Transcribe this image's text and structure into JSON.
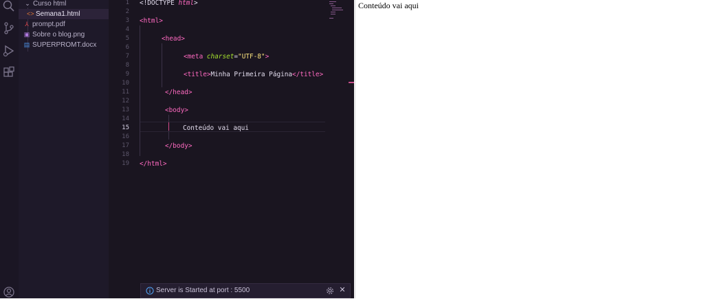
{
  "activity_bar": {
    "icons": [
      "search-icon",
      "source-control-icon",
      "run-debug-icon",
      "extensions-icon",
      "account-icon"
    ]
  },
  "explorer": {
    "folder_label": "Curso html",
    "files": [
      {
        "label": "Semana1.html",
        "icon": "html-file-icon",
        "active": true
      },
      {
        "label": "prompt.pdf",
        "icon": "pdf-file-icon",
        "active": false
      },
      {
        "label": "Sobre o blog.png",
        "icon": "image-file-icon",
        "active": false
      },
      {
        "label": "SUPERPROMT.docx",
        "icon": "word-file-icon",
        "active": false
      }
    ]
  },
  "editor": {
    "current_line": "15",
    "line_numbers": [
      "1",
      "2",
      "3",
      "4",
      "5",
      "6",
      "7",
      "8",
      "9",
      "10",
      "11",
      "12",
      "13",
      "14",
      "15",
      "16",
      "17",
      "18",
      "19"
    ],
    "code": {
      "l1_open": "<!DOCTYPE ",
      "l1_kw": "html",
      "l1_close": ">",
      "l3": "<html>",
      "l5": "<head>",
      "l7_open": "<meta ",
      "l7_attr": "charset",
      "l7_eq": "=",
      "l7_val": "\"UTF-8\"",
      "l7_close": ">",
      "l9_open": "<title>",
      "l9_text": "Minha Primeira Página",
      "l9_close": "</title>",
      "l11": "</head>",
      "l13": "<body>",
      "l15": "Conteúdo vai aqui",
      "l17": "</body>",
      "l19": "</html>"
    }
  },
  "notification": {
    "message": "Server is Started at port : 5500"
  },
  "preview": {
    "text": "Conteúdo vai aqui"
  },
  "colors": {
    "tag": "#ff6ac1",
    "attribute": "#a6e22e",
    "string": "#f7e07c",
    "editor_bg": "#1a1520",
    "sidebar_bg": "#1e1929"
  }
}
